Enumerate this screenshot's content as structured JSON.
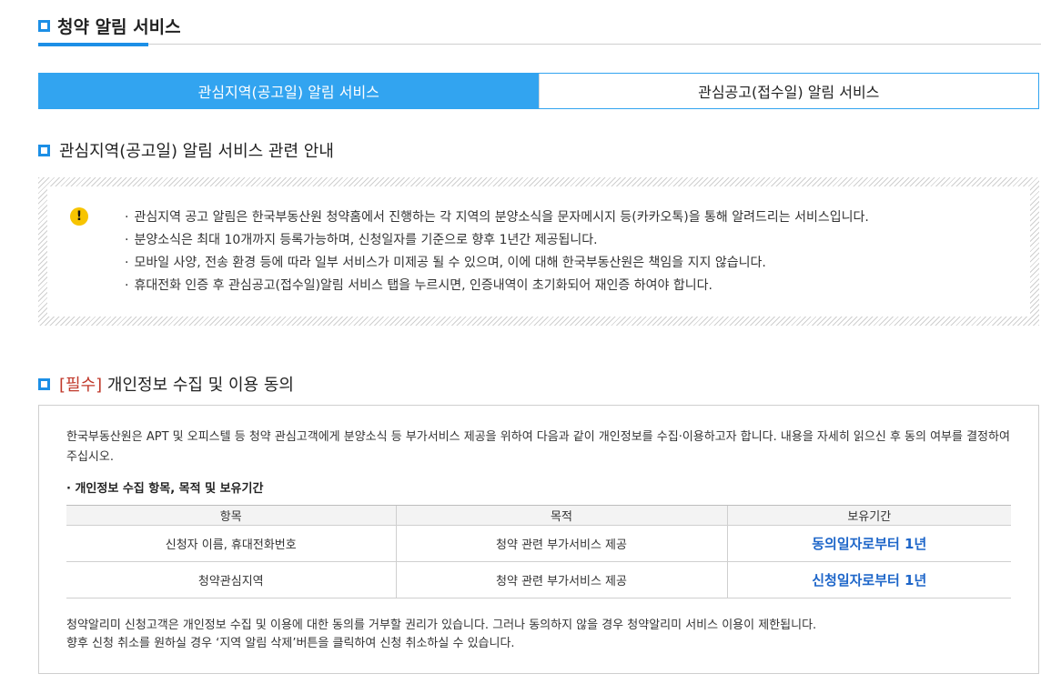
{
  "page": {
    "title": "청약 알림 서비스"
  },
  "tabs": [
    {
      "label": "관심지역(공고일) 알림 서비스"
    },
    {
      "label": "관심공고(접수일) 알림 서비스"
    }
  ],
  "notice": {
    "heading": "관심지역(공고일) 알림 서비스 관련 안내",
    "bullet": "·",
    "icon": "warning-icon",
    "items": [
      "관심지역 공고 알림은 한국부동산원 청약홈에서 진행하는 각 지역의 분양소식을 문자메시지 등(카카오톡)을 통해 알려드리는 서비스입니다.",
      "분양소식은 최대 10개까지 등록가능하며, 신청일자를 기준으로 향후 1년간 제공됩니다.",
      "모바일 사양, 전송 환경 등에 따라 일부 서비스가 미제공 될 수 있으며, 이에 대해 한국부동산원은 책임을 지지 않습니다.",
      "휴대전화 인증 후 관심공고(접수일)알림 서비스 탭을 누르시면, 인증내역이 초기화되어 재인증 하여야 합니다."
    ]
  },
  "consent": {
    "heading_required": "[필수]",
    "heading_text": "개인정보 수집 및 이용 동의",
    "intro": "한국부동산원은 APT 및 오피스텔 등 청약 관심고객에게 분양소식 등 부가서비스 제공을 위하여 다음과 같이 개인정보를 수집·이용하고자 합니다. 내용을 자세히 읽으신 후 동의 여부를 결정하여 주십시오.",
    "subhead": "· 개인정보 수집 항목, 목적 및 보유기간",
    "table": {
      "headers": [
        "항목",
        "목적",
        "보유기간"
      ],
      "rows": [
        [
          "신청자 이름, 휴대전화번호",
          "청약 관련 부가서비스 제공",
          "동의일자로부터 1년"
        ],
        [
          "청약관심지역",
          "청약 관련 부가서비스 제공",
          "신청일자로부터 1년"
        ]
      ]
    },
    "footer_line1": "청약알리미 신청고객은 개인정보 수집 및 이용에 대한 동의를 거부할 권리가 있습니다. 그러나 동의하지 않을 경우 청약알리미 서비스 이용이 제한됩니다.",
    "footer_line2": "향후 신청 취소를 원하실 경우 ‘지역 알림 삭제’버튼을 클릭하여 신청 취소하실 수 있습니다."
  },
  "colors": {
    "accent": "#1c8fe6",
    "tab_active": "#32a4f0",
    "required": "#c0392b",
    "emphasis": "#1e66c9",
    "warning": "#f7c400"
  }
}
